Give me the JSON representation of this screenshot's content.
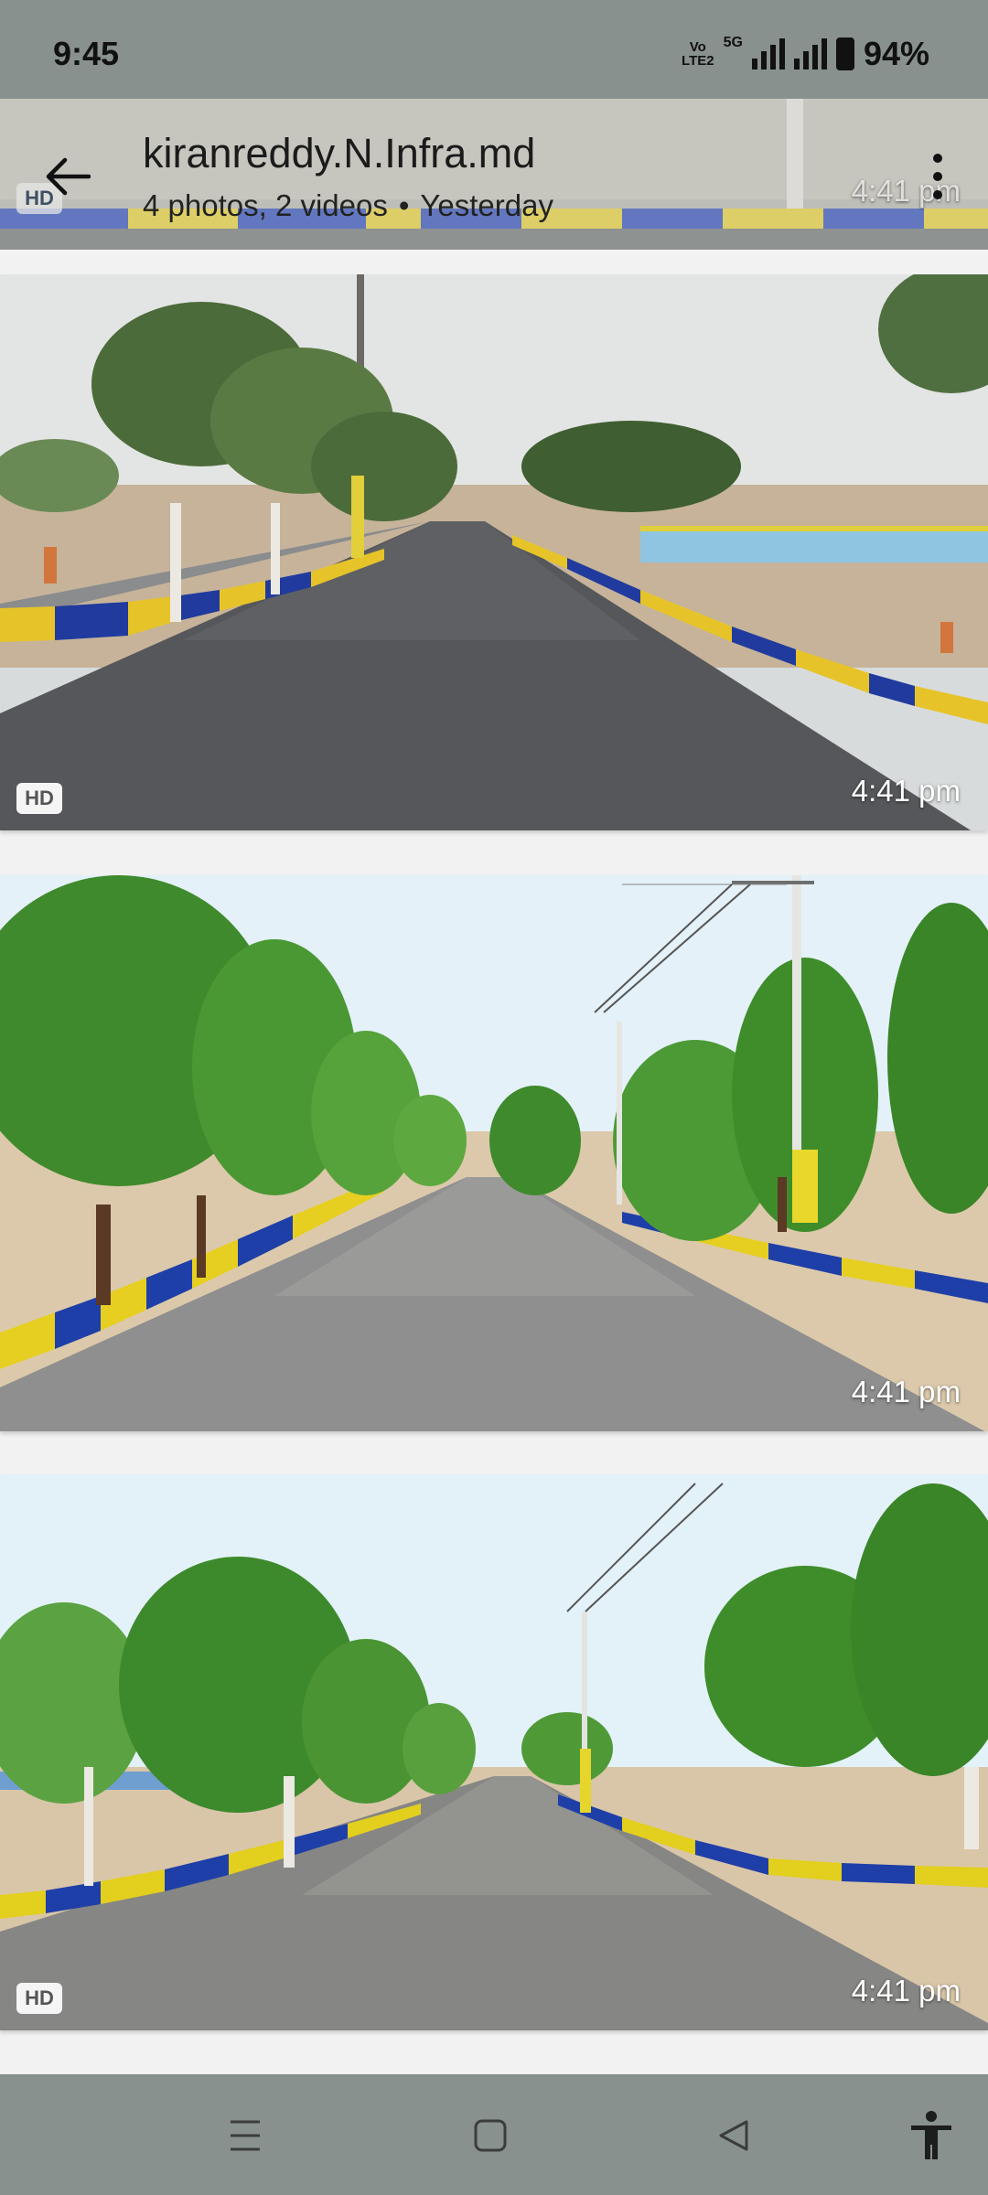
{
  "status_bar": {
    "time": "9:45",
    "volte_line1": "Vo",
    "volte_line2": "LTE2",
    "network": "5G",
    "battery": "94%"
  },
  "header": {
    "title": "kiranreddy.N.Infra.md",
    "subtitle_counts": "4 photos, 2 videos",
    "subtitle_separator": "•",
    "subtitle_date": "Yesterday",
    "back_icon": "arrow-left-icon",
    "menu_icon": "more-vertical-icon"
  },
  "photos": [
    {
      "hd_badge": "HD",
      "time": "4:41 pm"
    },
    {
      "hd_badge": "HD",
      "time": "4:41 pm"
    },
    {
      "hd_badge": "",
      "time": "4:41 pm"
    },
    {
      "hd_badge": "HD",
      "time": "4:41 pm"
    }
  ],
  "nav_bar": {
    "icons": [
      "recent-apps-icon",
      "home-icon",
      "back-icon",
      "accessibility-icon"
    ]
  },
  "colors": {
    "status_bar": "#89918f",
    "background": "#f2f2f2",
    "curb_yellow": "#f2d21b",
    "curb_blue": "#1f3fa8"
  }
}
